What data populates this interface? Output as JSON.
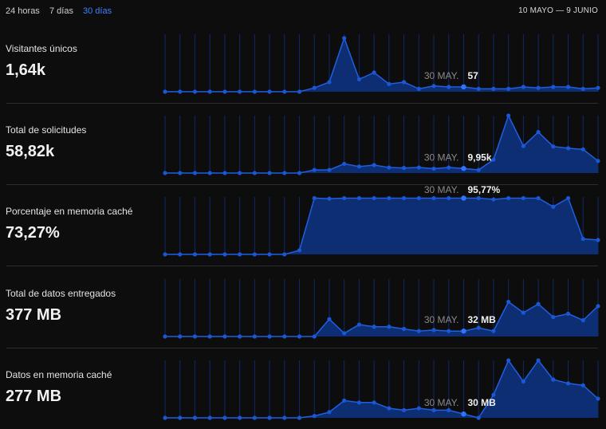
{
  "toolbar": {
    "tabs": [
      {
        "label": "24 horas",
        "active": false
      },
      {
        "label": "7 días",
        "active": false
      },
      {
        "label": "30 días",
        "active": true
      }
    ],
    "date_range": "10 MAYO — 9 JUNIO"
  },
  "colors": {
    "background": "#0d0d0e",
    "line": "#1f5fe0",
    "fill": "#0e2e74",
    "point": "#1a56d6",
    "highlight": "#2f74ff",
    "active_tab": "#3b82ff"
  },
  "hover": {
    "date": "30 MAY."
  },
  "panels": [
    {
      "label": "Visitantes únicos",
      "value": "1,64k",
      "hover_value": "57"
    },
    {
      "label": "Total de solicitudes",
      "value": "58,82k",
      "hover_value": "9,95k"
    },
    {
      "label": "Porcentaje en memoria caché",
      "value": "73,27%",
      "hover_value": "95,77%"
    },
    {
      "label": "Total de datos entregados",
      "value": "377 MB",
      "hover_value": "32 MB"
    },
    {
      "label": "Datos en memoria caché",
      "value": "277 MB",
      "hover_value": "30 MB"
    }
  ],
  "chart_data": [
    {
      "type": "area",
      "title": "Visitantes únicos",
      "x_count": 30,
      "highlight_index": 20,
      "ylim": [
        0,
        600
      ],
      "values": [
        0,
        0,
        0,
        0,
        0,
        0,
        0,
        0,
        0,
        0,
        40,
        100,
        560,
        130,
        200,
        80,
        100,
        30,
        60,
        50,
        50,
        30,
        30,
        30,
        50,
        40,
        50,
        50,
        30,
        40
      ]
    },
    {
      "type": "area",
      "title": "Total de solicitudes",
      "x_count": 30,
      "highlight_index": 20,
      "ylim": [
        0,
        9950
      ],
      "values": [
        0,
        0,
        0,
        0,
        0,
        0,
        0,
        0,
        0,
        0,
        540,
        540,
        1600,
        1130,
        1380,
        960,
        880,
        960,
        760,
        960,
        790,
        540,
        2320,
        9950,
        4680,
        7100,
        4600,
        4300,
        4100,
        2100
      ]
    },
    {
      "type": "area",
      "title": "Porcentaje en memoria caché",
      "x_count": 30,
      "highlight_index": 20,
      "ylim": [
        0,
        100
      ],
      "values": [
        0,
        0,
        0,
        0,
        0,
        0,
        0,
        0,
        0,
        7,
        98,
        97,
        98,
        98,
        98,
        98,
        98,
        98,
        98,
        98,
        98,
        98,
        95.77,
        98,
        98,
        98,
        83,
        98,
        27,
        25
      ]
    },
    {
      "type": "area",
      "title": "Total de datos entregados",
      "x_count": 30,
      "highlight_index": 20,
      "ylim": [
        0,
        53
      ],
      "values": [
        0,
        0,
        0,
        0,
        0,
        0,
        0,
        0,
        0,
        0,
        0,
        16,
        3,
        11,
        9,
        9,
        7,
        5,
        6,
        5,
        5,
        8,
        5,
        32,
        22,
        30,
        18,
        21,
        15,
        28
      ]
    },
    {
      "type": "area",
      "title": "Datos en memoria caché",
      "x_count": 30,
      "highlight_index": 20,
      "ylim": [
        0,
        30
      ],
      "values": [
        0,
        0,
        0,
        0,
        0,
        0,
        0,
        0,
        0,
        0,
        1,
        3,
        9,
        8,
        8,
        5,
        4,
        5,
        4,
        4,
        2,
        0,
        12,
        30,
        19,
        30,
        20,
        18,
        17,
        10
      ]
    }
  ]
}
